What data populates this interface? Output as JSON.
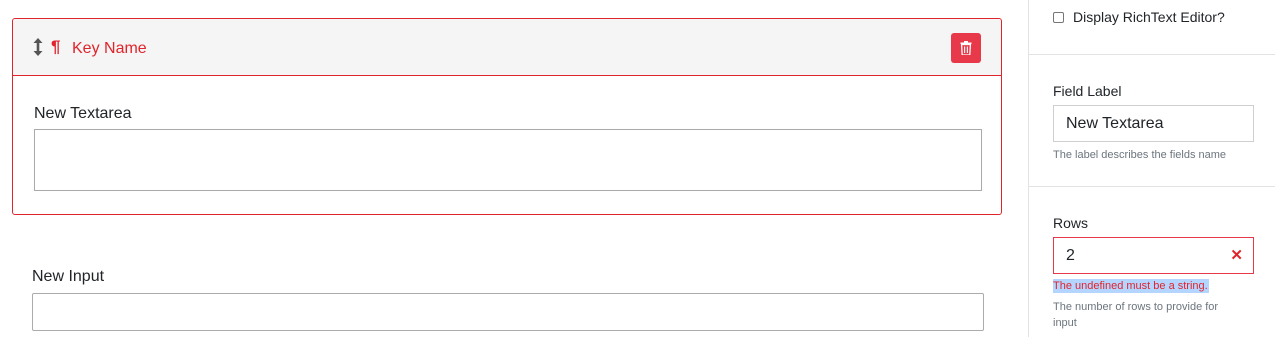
{
  "field_card": {
    "title": "Key Name",
    "textarea_label": "New Textarea",
    "textarea_value": ""
  },
  "next_field": {
    "label": "New Input",
    "value": ""
  },
  "settings": {
    "richtext_label": "Display RichText Editor?",
    "richtext_checked": false,
    "field_label": {
      "label": "Field Label",
      "value": "New Textarea",
      "help": "The label describes the fields name"
    },
    "rows": {
      "label": "Rows",
      "value": "2",
      "error": "The undefined must be a string.",
      "help_line1": "The number of rows to provide for",
      "help_line2": "input"
    }
  },
  "icons": {
    "drag": "up-down-arrow-icon",
    "type": "pilcrow-icon",
    "delete": "trash-icon",
    "clear": "x-icon"
  },
  "colors": {
    "accent_red": "#e0242c",
    "delete_button": "#e8394a",
    "selection_highlight": "#b4d5ff"
  }
}
